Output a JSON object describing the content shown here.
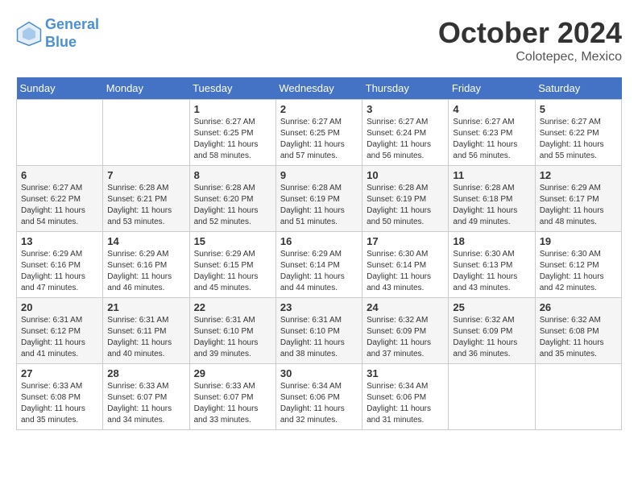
{
  "header": {
    "logo_line1": "General",
    "logo_line2": "Blue",
    "month": "October 2024",
    "location": "Colotepec, Mexico"
  },
  "weekdays": [
    "Sunday",
    "Monday",
    "Tuesday",
    "Wednesday",
    "Thursday",
    "Friday",
    "Saturday"
  ],
  "weeks": [
    [
      {
        "day": "",
        "info": ""
      },
      {
        "day": "",
        "info": ""
      },
      {
        "day": "1",
        "info": "Sunrise: 6:27 AM\nSunset: 6:25 PM\nDaylight: 11 hours and 58 minutes."
      },
      {
        "day": "2",
        "info": "Sunrise: 6:27 AM\nSunset: 6:25 PM\nDaylight: 11 hours and 57 minutes."
      },
      {
        "day": "3",
        "info": "Sunrise: 6:27 AM\nSunset: 6:24 PM\nDaylight: 11 hours and 56 minutes."
      },
      {
        "day": "4",
        "info": "Sunrise: 6:27 AM\nSunset: 6:23 PM\nDaylight: 11 hours and 56 minutes."
      },
      {
        "day": "5",
        "info": "Sunrise: 6:27 AM\nSunset: 6:22 PM\nDaylight: 11 hours and 55 minutes."
      }
    ],
    [
      {
        "day": "6",
        "info": "Sunrise: 6:27 AM\nSunset: 6:22 PM\nDaylight: 11 hours and 54 minutes."
      },
      {
        "day": "7",
        "info": "Sunrise: 6:28 AM\nSunset: 6:21 PM\nDaylight: 11 hours and 53 minutes."
      },
      {
        "day": "8",
        "info": "Sunrise: 6:28 AM\nSunset: 6:20 PM\nDaylight: 11 hours and 52 minutes."
      },
      {
        "day": "9",
        "info": "Sunrise: 6:28 AM\nSunset: 6:19 PM\nDaylight: 11 hours and 51 minutes."
      },
      {
        "day": "10",
        "info": "Sunrise: 6:28 AM\nSunset: 6:19 PM\nDaylight: 11 hours and 50 minutes."
      },
      {
        "day": "11",
        "info": "Sunrise: 6:28 AM\nSunset: 6:18 PM\nDaylight: 11 hours and 49 minutes."
      },
      {
        "day": "12",
        "info": "Sunrise: 6:29 AM\nSunset: 6:17 PM\nDaylight: 11 hours and 48 minutes."
      }
    ],
    [
      {
        "day": "13",
        "info": "Sunrise: 6:29 AM\nSunset: 6:16 PM\nDaylight: 11 hours and 47 minutes."
      },
      {
        "day": "14",
        "info": "Sunrise: 6:29 AM\nSunset: 6:16 PM\nDaylight: 11 hours and 46 minutes."
      },
      {
        "day": "15",
        "info": "Sunrise: 6:29 AM\nSunset: 6:15 PM\nDaylight: 11 hours and 45 minutes."
      },
      {
        "day": "16",
        "info": "Sunrise: 6:29 AM\nSunset: 6:14 PM\nDaylight: 11 hours and 44 minutes."
      },
      {
        "day": "17",
        "info": "Sunrise: 6:30 AM\nSunset: 6:14 PM\nDaylight: 11 hours and 43 minutes."
      },
      {
        "day": "18",
        "info": "Sunrise: 6:30 AM\nSunset: 6:13 PM\nDaylight: 11 hours and 43 minutes."
      },
      {
        "day": "19",
        "info": "Sunrise: 6:30 AM\nSunset: 6:12 PM\nDaylight: 11 hours and 42 minutes."
      }
    ],
    [
      {
        "day": "20",
        "info": "Sunrise: 6:31 AM\nSunset: 6:12 PM\nDaylight: 11 hours and 41 minutes."
      },
      {
        "day": "21",
        "info": "Sunrise: 6:31 AM\nSunset: 6:11 PM\nDaylight: 11 hours and 40 minutes."
      },
      {
        "day": "22",
        "info": "Sunrise: 6:31 AM\nSunset: 6:10 PM\nDaylight: 11 hours and 39 minutes."
      },
      {
        "day": "23",
        "info": "Sunrise: 6:31 AM\nSunset: 6:10 PM\nDaylight: 11 hours and 38 minutes."
      },
      {
        "day": "24",
        "info": "Sunrise: 6:32 AM\nSunset: 6:09 PM\nDaylight: 11 hours and 37 minutes."
      },
      {
        "day": "25",
        "info": "Sunrise: 6:32 AM\nSunset: 6:09 PM\nDaylight: 11 hours and 36 minutes."
      },
      {
        "day": "26",
        "info": "Sunrise: 6:32 AM\nSunset: 6:08 PM\nDaylight: 11 hours and 35 minutes."
      }
    ],
    [
      {
        "day": "27",
        "info": "Sunrise: 6:33 AM\nSunset: 6:08 PM\nDaylight: 11 hours and 35 minutes."
      },
      {
        "day": "28",
        "info": "Sunrise: 6:33 AM\nSunset: 6:07 PM\nDaylight: 11 hours and 34 minutes."
      },
      {
        "day": "29",
        "info": "Sunrise: 6:33 AM\nSunset: 6:07 PM\nDaylight: 11 hours and 33 minutes."
      },
      {
        "day": "30",
        "info": "Sunrise: 6:34 AM\nSunset: 6:06 PM\nDaylight: 11 hours and 32 minutes."
      },
      {
        "day": "31",
        "info": "Sunrise: 6:34 AM\nSunset: 6:06 PM\nDaylight: 11 hours and 31 minutes."
      },
      {
        "day": "",
        "info": ""
      },
      {
        "day": "",
        "info": ""
      }
    ]
  ]
}
